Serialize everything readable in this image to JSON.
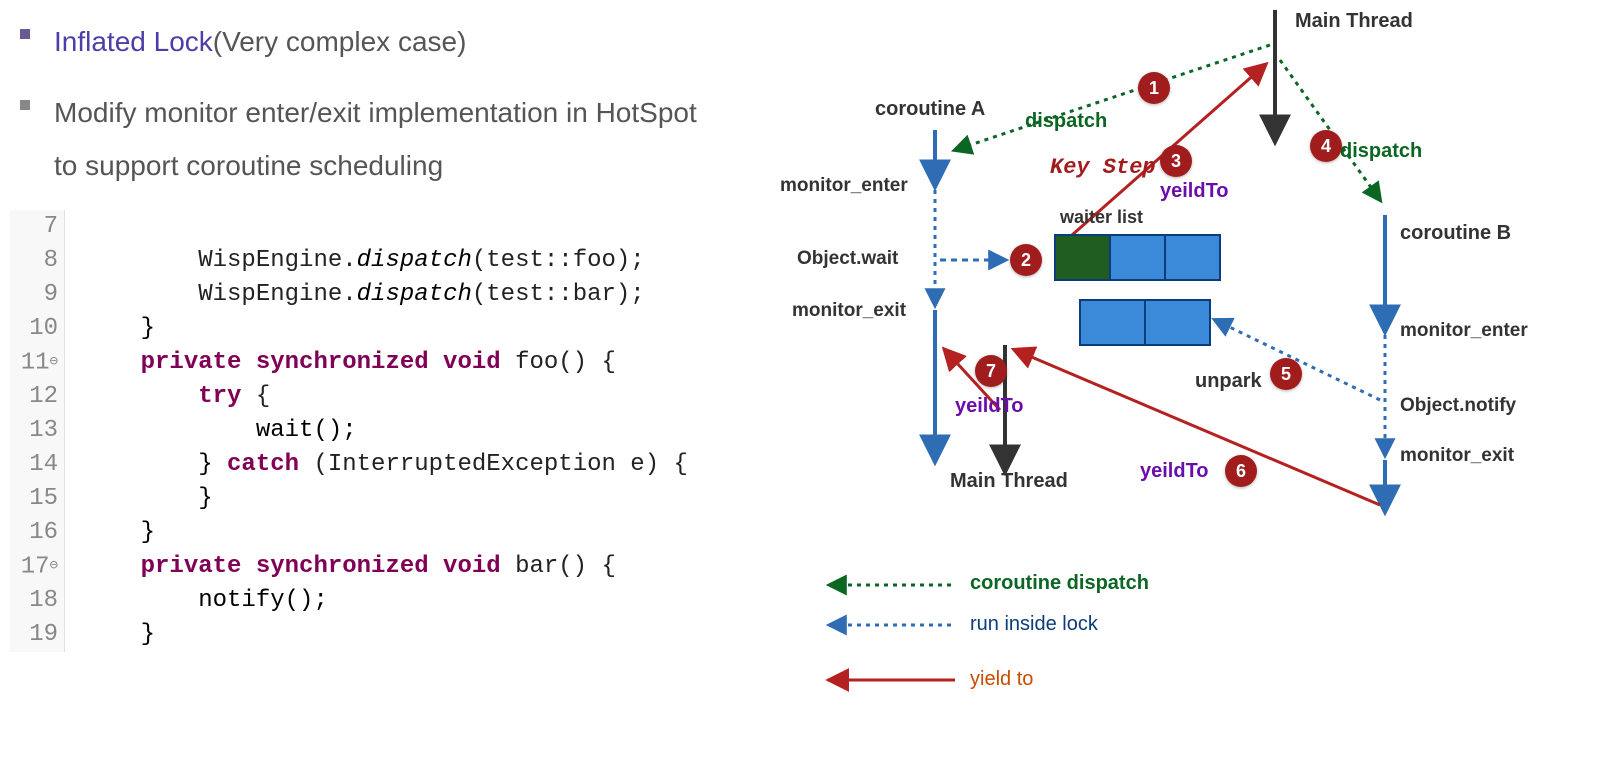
{
  "bullets": {
    "b1_colored": "Inflated Lock",
    "b1_rest": "(Very complex case)",
    "b2": "Modify monitor enter/exit implementation in HotSpot to support coroutine scheduling"
  },
  "code": {
    "l7": "",
    "l8": "WispEngine.dispatch(test::foo);",
    "l9": "WispEngine.dispatch(test::bar);",
    "l10": "}",
    "l11_kw": "private synchronized void",
    "l11_rest": " foo() {",
    "l12_kw": "try",
    "l12_rest": " {",
    "l13": "wait();",
    "l14_a": "} ",
    "l14_kw": "catch",
    "l14_b": " (InterruptedException e) {",
    "l15": "}",
    "l16": "}",
    "l17_kw": "private synchronized void",
    "l17_rest": " bar() {",
    "l18": "notify();",
    "l19": "}"
  },
  "diagram": {
    "main_thread_top": "Main Thread",
    "main_thread_mid": "Main Thread",
    "coroutine_a": "coroutine A",
    "coroutine_b": "coroutine B",
    "monitor_enter": "monitor_enter",
    "monitor_exit": "monitor_exit",
    "object_wait": "Object.wait",
    "object_notify": "Object.notify",
    "waiter_list": "waiter  list",
    "dispatch": "dispatch",
    "yeildTo": "yeildTo",
    "key_step": "Key Step",
    "unpark": "unpark",
    "steps": {
      "s1": "1",
      "s2": "2",
      "s3": "3",
      "s4": "4",
      "s5": "5",
      "s6": "6",
      "s7": "7"
    }
  },
  "legend": {
    "dispatch": "coroutine dispatch",
    "inside_lock": "run inside lock",
    "yield_to": "yield to"
  }
}
